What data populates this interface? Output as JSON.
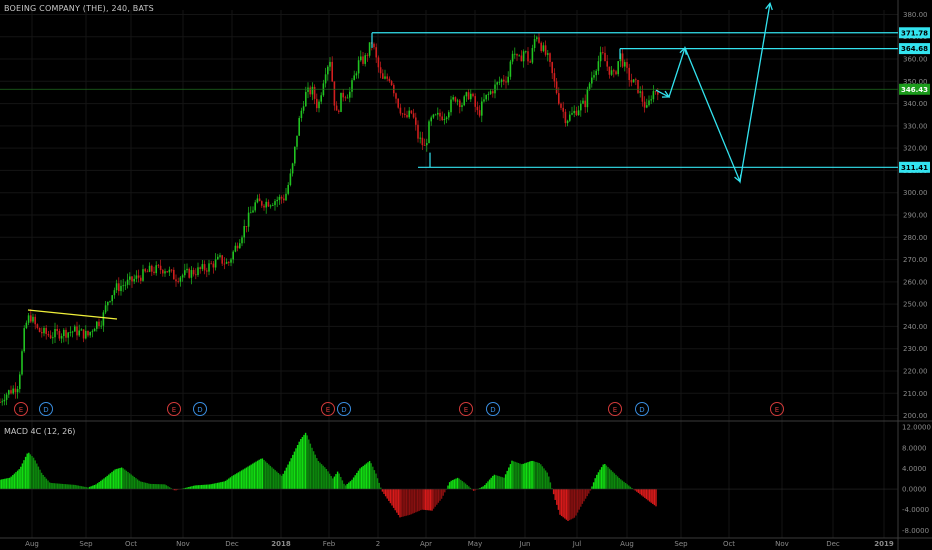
{
  "chart_title": "BOEING COMPANY (THE), 240, BATS",
  "indicator_title": "MACD 4C (12, 26)",
  "colors": {
    "up": "#21c321",
    "down": "#d01f1f",
    "line_cyan": "#33e3ef",
    "line_yellow": "#f0f03a",
    "current_price_bg": "#1c9c1c",
    "tag_bg": "#33e3ef",
    "grid": "#141414",
    "axis_text": "#8a8a8a"
  },
  "chart_data": [
    {
      "type": "candlestick",
      "title": "BOEING COMPANY (THE), 240, BATS",
      "x_tick_labels": [
        "Aug",
        "Sep",
        "Oct",
        "Nov",
        "Dec",
        "2018",
        "Feb",
        "2",
        "Apr",
        "May",
        "Jun",
        "Jul",
        "Aug",
        "Sep",
        "Oct",
        "Nov",
        "Dec",
        "2019"
      ],
      "y_tick_labels": [
        "200.00",
        "210.00",
        "220.00",
        "230.00",
        "240.00",
        "250.00",
        "260.00",
        "270.00",
        "280.00",
        "290.00",
        "300.00",
        "310.00",
        "320.00",
        "330.00",
        "340.00",
        "350.00",
        "360.00",
        "370.00",
        "380.00"
      ],
      "ylim": [
        198,
        382
      ],
      "price_path": [
        [
          0,
          206
        ],
        [
          4,
          209
        ],
        [
          10,
          211
        ],
        [
          14,
          212
        ],
        [
          18,
          214
        ],
        [
          21,
          224
        ],
        [
          25,
          240
        ],
        [
          30,
          245
        ],
        [
          38,
          238
        ],
        [
          50,
          236
        ],
        [
          60,
          237
        ],
        [
          75,
          238
        ],
        [
          88,
          236
        ],
        [
          95,
          241
        ],
        [
          102,
          243
        ],
        [
          108,
          252
        ],
        [
          115,
          257
        ],
        [
          130,
          260
        ],
        [
          150,
          265
        ],
        [
          165,
          266
        ],
        [
          175,
          262
        ],
        [
          190,
          264
        ],
        [
          205,
          266
        ],
        [
          220,
          270
        ],
        [
          228,
          268
        ],
        [
          238,
          278
        ],
        [
          248,
          288
        ],
        [
          255,
          295
        ],
        [
          270,
          296
        ],
        [
          285,
          298
        ],
        [
          292,
          310
        ],
        [
          298,
          330
        ],
        [
          305,
          344
        ],
        [
          312,
          346
        ],
        [
          318,
          338
        ],
        [
          325,
          355
        ],
        [
          330,
          360
        ],
        [
          336,
          334
        ],
        [
          342,
          344
        ],
        [
          350,
          345
        ],
        [
          358,
          358
        ],
        [
          365,
          360
        ],
        [
          372,
          368
        ],
        [
          376,
          360
        ],
        [
          382,
          350
        ],
        [
          390,
          352
        ],
        [
          398,
          340
        ],
        [
          405,
          333
        ],
        [
          412,
          336
        ],
        [
          418,
          325
        ],
        [
          425,
          320
        ],
        [
          430,
          332
        ],
        [
          437,
          334
        ],
        [
          445,
          335
        ],
        [
          455,
          343
        ],
        [
          462,
          340
        ],
        [
          470,
          345
        ],
        [
          478,
          335
        ],
        [
          485,
          342
        ],
        [
          492,
          346
        ],
        [
          500,
          350
        ],
        [
          508,
          352
        ],
        [
          513,
          365
        ],
        [
          518,
          358
        ],
        [
          524,
          364
        ],
        [
          530,
          358
        ],
        [
          536,
          372
        ],
        [
          542,
          365
        ],
        [
          548,
          360
        ],
        [
          555,
          348
        ],
        [
          560,
          340
        ],
        [
          566,
          333
        ],
        [
          572,
          335
        ],
        [
          578,
          338
        ],
        [
          585,
          340
        ],
        [
          590,
          350
        ],
        [
          597,
          358
        ],
        [
          602,
          362
        ],
        [
          608,
          356
        ],
        [
          614,
          352
        ],
        [
          620,
          362
        ],
        [
          625,
          356
        ],
        [
          631,
          350
        ],
        [
          637,
          348
        ],
        [
          642,
          342
        ],
        [
          647,
          337
        ],
        [
          652,
          345
        ],
        [
          656,
          346
        ],
        [
          660,
          347
        ]
      ],
      "resistance_1": 371.78,
      "resistance_2": 364.68,
      "support": 311.41,
      "current_price": 346.43,
      "price_tags": [
        "371.78",
        "364.68",
        "346.43",
        "311.41"
      ],
      "event_markers": [
        {
          "label": "E",
          "kind": "earnings"
        },
        {
          "label": "D",
          "kind": "dividend"
        },
        {
          "label": "E",
          "kind": "earnings"
        },
        {
          "label": "D",
          "kind": "dividend"
        },
        {
          "label": "E",
          "kind": "earnings"
        },
        {
          "label": "D",
          "kind": "dividend"
        },
        {
          "label": "E",
          "kind": "earnings"
        },
        {
          "label": "D",
          "kind": "dividend"
        },
        {
          "label": "E",
          "kind": "earnings"
        },
        {
          "label": "D",
          "kind": "dividend"
        },
        {
          "label": "E",
          "kind": "earnings"
        }
      ],
      "projection_path": [
        [
          656,
          346
        ],
        [
          669,
          343
        ],
        [
          685,
          365
        ],
        [
          740,
          305
        ],
        [
          770,
          385
        ]
      ]
    },
    {
      "type": "histogram",
      "title": "MACD 4C (12, 26)",
      "y_tick_labels": [
        "12.0000",
        "8.0000",
        "4.0000",
        "0.0000",
        "-4.0000",
        "-8.0000"
      ],
      "ylim": [
        -9.5,
        13
      ],
      "values_path": [
        [
          0,
          1.8
        ],
        [
          10,
          2.2
        ],
        [
          20,
          4
        ],
        [
          28,
          7.2
        ],
        [
          34,
          6
        ],
        [
          42,
          3
        ],
        [
          50,
          1.2
        ],
        [
          62,
          1
        ],
        [
          75,
          0.8
        ],
        [
          88,
          0.3
        ],
        [
          96,
          0.9
        ],
        [
          105,
          2.2
        ],
        [
          115,
          3.8
        ],
        [
          122,
          4.2
        ],
        [
          130,
          3
        ],
        [
          140,
          1.5
        ],
        [
          150,
          1
        ],
        [
          165,
          0.9
        ],
        [
          175,
          -0.3
        ],
        [
          185,
          0.2
        ],
        [
          195,
          0.7
        ],
        [
          210,
          0.9
        ],
        [
          225,
          1.5
        ],
        [
          232,
          2.5
        ],
        [
          245,
          4
        ],
        [
          255,
          5.2
        ],
        [
          262,
          6
        ],
        [
          272,
          4.2
        ],
        [
          282,
          2.5
        ],
        [
          290,
          5.5
        ],
        [
          300,
          9.5
        ],
        [
          306,
          11
        ],
        [
          312,
          8
        ],
        [
          318,
          5.5
        ],
        [
          326,
          4
        ],
        [
          333,
          2
        ],
        [
          338,
          3.5
        ],
        [
          345,
          0.6
        ],
        [
          352,
          1.8
        ],
        [
          360,
          4
        ],
        [
          370,
          5.5
        ],
        [
          376,
          3
        ],
        [
          382,
          -0.4
        ],
        [
          392,
          -3.2
        ],
        [
          400,
          -5.5
        ],
        [
          410,
          -5
        ],
        [
          422,
          -4
        ],
        [
          432,
          -4.2
        ],
        [
          442,
          -1.8
        ],
        [
          450,
          1.5
        ],
        [
          458,
          2.2
        ],
        [
          466,
          1
        ],
        [
          474,
          -0.4
        ],
        [
          484,
          0.6
        ],
        [
          494,
          2.8
        ],
        [
          504,
          2.2
        ],
        [
          512,
          5.5
        ],
        [
          522,
          4.8
        ],
        [
          532,
          5.5
        ],
        [
          540,
          5
        ],
        [
          548,
          3
        ],
        [
          555,
          -2
        ],
        [
          560,
          -5
        ],
        [
          568,
          -6.2
        ],
        [
          575,
          -5.5
        ],
        [
          582,
          -3
        ],
        [
          590,
          -0.5
        ],
        [
          596,
          2.5
        ],
        [
          604,
          5
        ],
        [
          612,
          3.5
        ],
        [
          620,
          2
        ],
        [
          630,
          0.5
        ],
        [
          640,
          -1
        ],
        [
          650,
          -2.5
        ],
        [
          657,
          -3.5
        ]
      ]
    }
  ]
}
